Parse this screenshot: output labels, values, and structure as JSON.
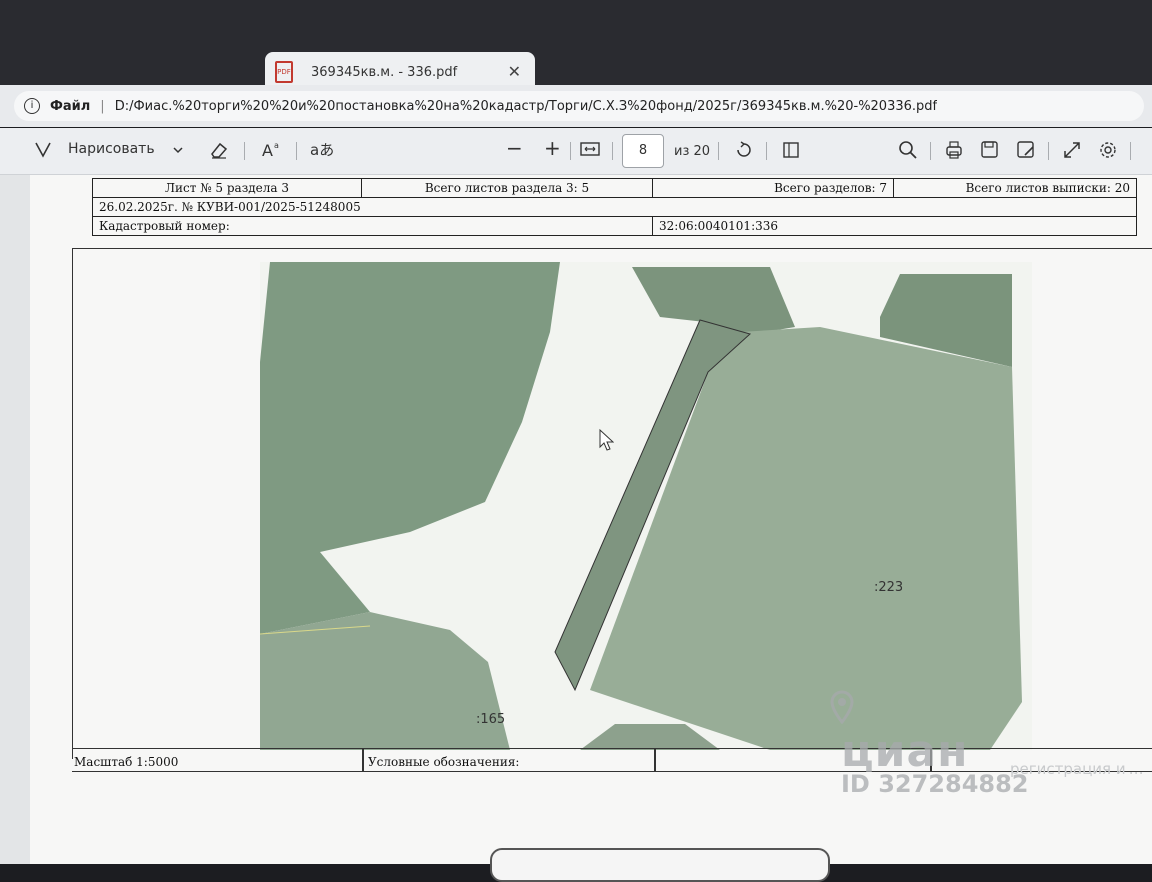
{
  "tab": {
    "title": "369345кв.м. - 336.pdf",
    "close": "✕"
  },
  "address": {
    "scheme": "Файл",
    "url": "D:/Фиас.%20торги%20%20и%20постановка%20на%20кадастр/Торги/С.Х.З%20фонд/2025г/369345кв.м.%20-%20336.pdf"
  },
  "toolbar": {
    "draw_label": "Нарисовать",
    "zoom_out": "−",
    "zoom_in": "+",
    "current_page": "8",
    "total_pages": "из 20",
    "icons": [
      "draw-icon",
      "chevron-down-icon",
      "eraser-icon",
      "text-icon",
      "read-aloud-icon",
      "zoom-out-icon",
      "zoom-in-icon",
      "fit-width-icon",
      "rotate-icon",
      "page-view-icon",
      "search-icon",
      "print-icon",
      "save-icon",
      "save-as-icon",
      "fullscreen-icon",
      "settings-icon"
    ]
  },
  "document": {
    "sheet": "Лист № 5 раздела 3",
    "sheets_in_section": "Всего листов раздела 3: 5",
    "sections_total": "Всего разделов: 7",
    "sheets_total": "Всего листов выписки: 20",
    "date_number": "26.02.2025г. № КУВИ-001/2025-51248005",
    "cadastral_label": "Кадастровый номер:",
    "cadastral_value": "32:06:0040101:336",
    "scale": "Масштаб 1:5000",
    "legend": "Условные обозначения:",
    "parcel_labels": [
      ":223",
      ":165"
    ]
  },
  "watermark": {
    "brand": "циан",
    "id": "ID 327284882",
    "side_text": "регистрация и …"
  },
  "colors": {
    "parcel_fill": "#98ad97",
    "white_area": "#eef1ec",
    "tab_active": "#eef0f2",
    "pdf_red": "#c2392f"
  }
}
